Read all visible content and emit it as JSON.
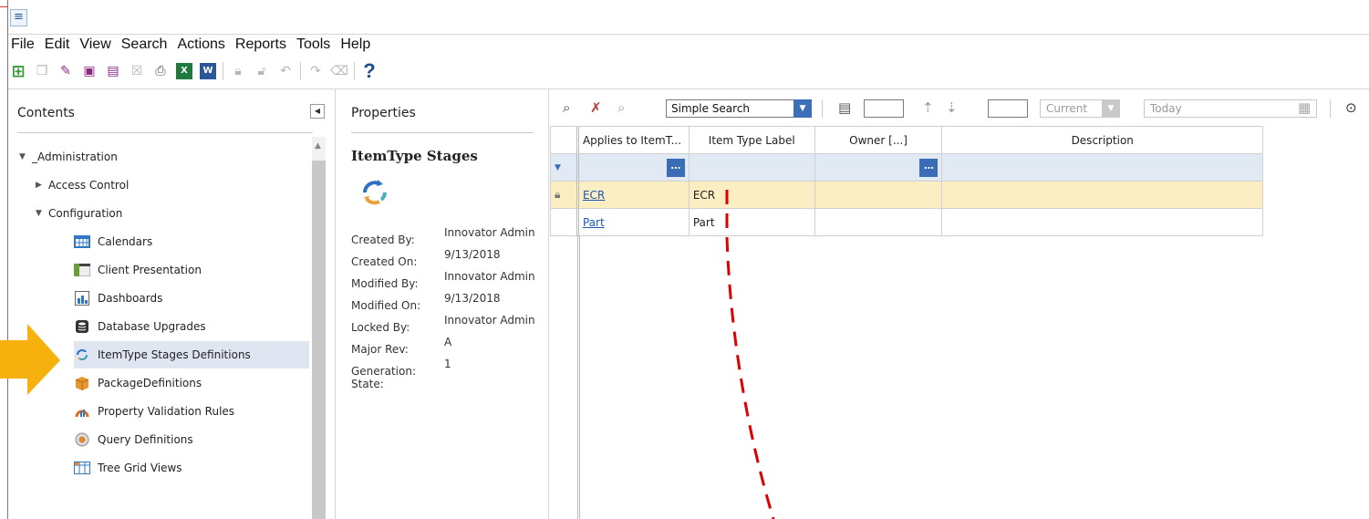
{
  "menu": [
    "File",
    "Edit",
    "View",
    "Search",
    "Actions",
    "Reports",
    "Tools",
    "Help"
  ],
  "toolbar": {
    "icons": [
      "new-item-icon",
      "copy-icon",
      "edit-icon",
      "save-icon",
      "save-close-icon",
      "discard-icon",
      "print-icon",
      "excel-icon",
      "word-icon",
      "lock-icon",
      "unlock-icon",
      "undo-icon",
      "redo-icon",
      "delete-icon",
      "help-icon"
    ],
    "excel_label": "X",
    "word_label": "W",
    "help_label": "?"
  },
  "contents": {
    "title": "Contents",
    "tree": [
      {
        "label": "_Administration",
        "level": 0,
        "expanded": true,
        "icon": "expanded-arrow"
      },
      {
        "label": "Access Control",
        "level": 1,
        "expanded": false,
        "icon": "collapsed-arrow"
      },
      {
        "label": "Configuration",
        "level": 1,
        "expanded": true,
        "icon": "expanded-arrow"
      },
      {
        "label": "Calendars",
        "level": 2,
        "icon": "calendar-icon"
      },
      {
        "label": "Client Presentation",
        "level": 2,
        "icon": "presentation-icon"
      },
      {
        "label": "Dashboards",
        "level": 2,
        "icon": "dashboard-icon"
      },
      {
        "label": "Database Upgrades",
        "level": 2,
        "icon": "database-icon"
      },
      {
        "label": "ItemType Stages Definitions",
        "level": 2,
        "icon": "stages-icon",
        "selected": true
      },
      {
        "label": "PackageDefinitions",
        "level": 2,
        "icon": "package-icon"
      },
      {
        "label": "Property Validation Rules",
        "level": 2,
        "icon": "validation-icon"
      },
      {
        "label": "Query Definitions",
        "level": 2,
        "icon": "query-icon"
      },
      {
        "label": "Tree Grid Views",
        "level": 2,
        "icon": "treegrid-icon"
      }
    ]
  },
  "properties": {
    "title": "Properties",
    "item_name": "ItemType Stages",
    "fields": [
      {
        "label": "Created By:",
        "value": "Innovator Admin"
      },
      {
        "label": "Created On:",
        "value": "9/13/2018"
      },
      {
        "label": "Modified By:",
        "value": "Innovator Admin"
      },
      {
        "label": "Modified On:",
        "value": "9/13/2018"
      },
      {
        "label": "Locked By:",
        "value": "Innovator Admin"
      },
      {
        "label": "Major Rev:",
        "value": "A"
      },
      {
        "label": "Generation:",
        "value": "1"
      },
      {
        "label": "State:",
        "value": ""
      }
    ]
  },
  "search_bar": {
    "mode": "Simple Search",
    "page_size": "",
    "max_results": "",
    "version": "Current",
    "date_placeholder": "Today"
  },
  "grid": {
    "columns": [
      "Applies to ItemT...",
      "Item Type Label",
      "Owner [...]",
      "Description"
    ],
    "rows": [
      {
        "applies_to": "ECR",
        "label": "ECR",
        "owner": "",
        "description": "",
        "locked": true
      },
      {
        "applies_to": "Part",
        "label": "Part",
        "owner": "",
        "description": "",
        "locked": false
      }
    ]
  },
  "colors": {
    "accent": "#3a6db5",
    "selected_row": "#fbeec2",
    "filter_row": "#e1e9f5",
    "annotation_arrow": "#f6b10f",
    "annotation_line": "#dd0000"
  }
}
